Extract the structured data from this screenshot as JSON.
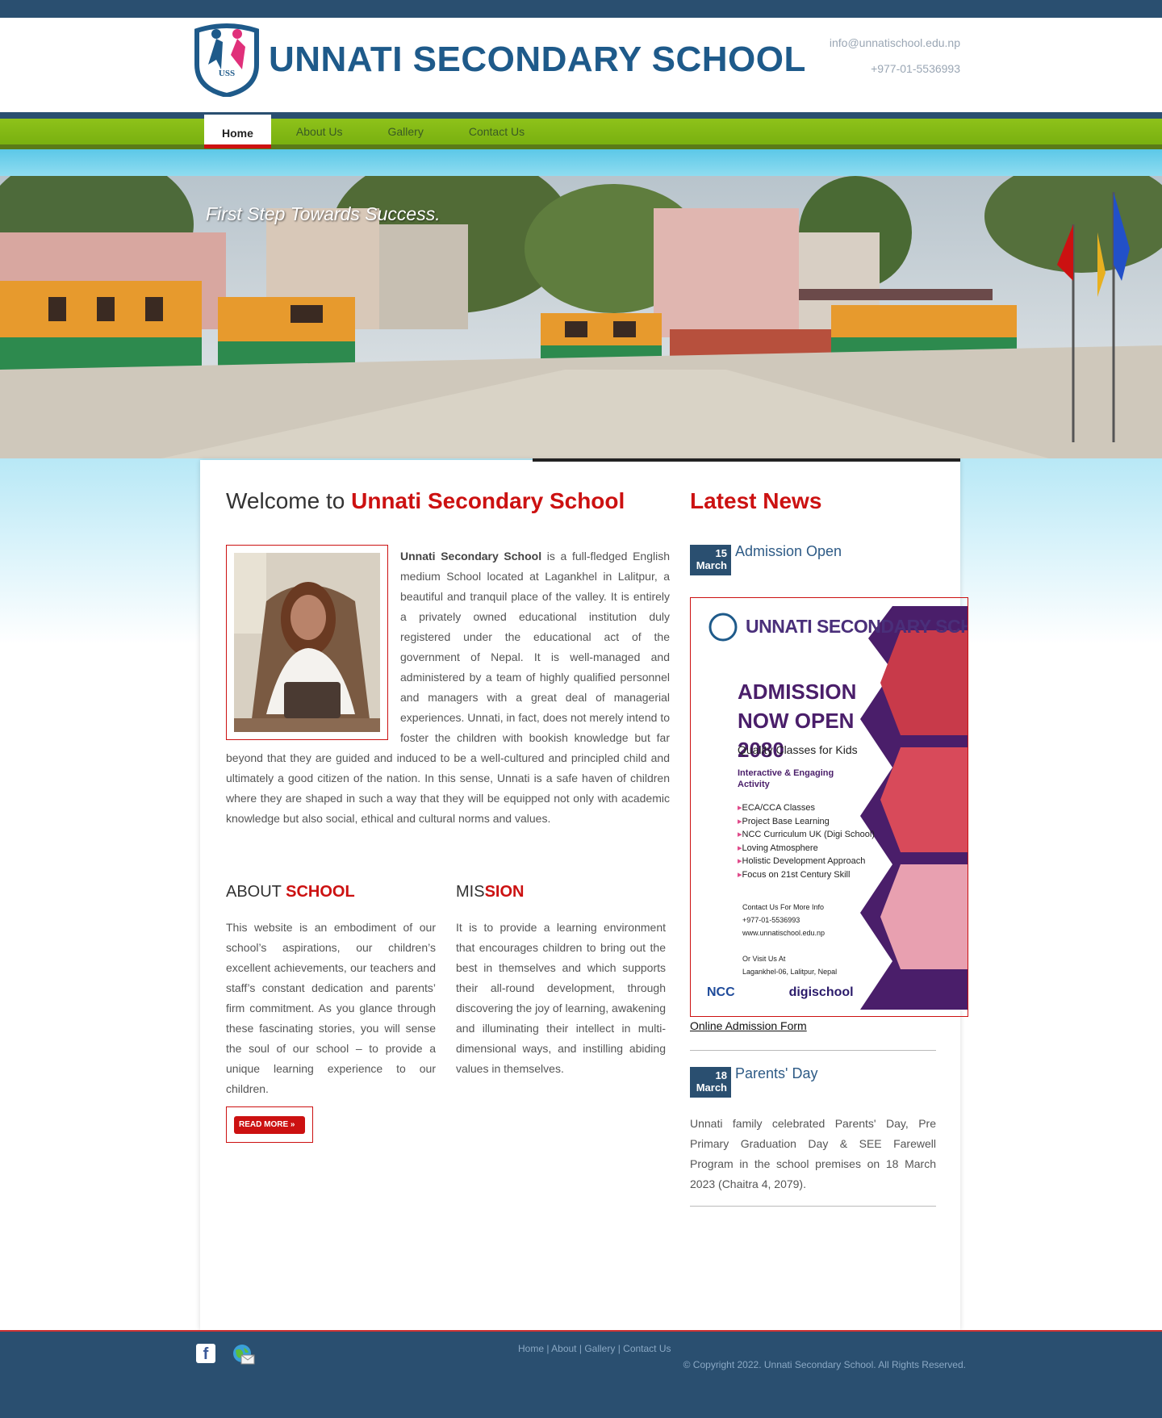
{
  "header": {
    "title": "UNNATI SECONDARY SCHOOL",
    "logo_text": "USS",
    "email": "info@unnatischool.edu.np",
    "phone": "+977-01-5536993"
  },
  "nav": {
    "items": [
      {
        "label": "Home"
      },
      {
        "label": "About Us"
      },
      {
        "label": "Gallery"
      },
      {
        "label": "Contact Us"
      }
    ]
  },
  "banner": {
    "tagline": "First Step Towards Success."
  },
  "welcome": {
    "prefix": "Welcome to",
    "highlight": "Unnati Secondary School",
    "intro_bold": "Unnati Secondary School",
    "intro_text": " is a full-fledged English medium School located at Lagankhel in Lalitpur, a beautiful and tranquil place of the valley. It is entirely a privately owned educational institution duly registered under the educational act of the government of Nepal. It is well-managed and administered by a team of highly qualified personnel and managers with a great deal of managerial experiences. Unnati, in fact, does not merely intend to foster the children with bookish knowledge but far beyond that they are guided and induced to be a well-cultured and principled child and ultimately a good citizen of the nation. In this sense, Unnati is a safe haven of children where they are shaped in such a way that they will be equipped not only with academic knowledge but also social, ethical and cultural norms and values."
  },
  "about": {
    "title_plain": "ABOUT",
    "title_highlight": "SCHOOL",
    "text": "This website is an embodiment of our school’s aspirations, our children’s excellent achievements, our teachers and staff’s constant dedication and parents’ firm commitment. As you glance through these fascinating stories, you will sense the soul of our school – to provide a unique learning experience to our children.",
    "read_more": "READ MORE"
  },
  "mission": {
    "title_plain": "MIS",
    "title_highlight": "SION",
    "text": "It is to provide a learning environment that encourages children to bring out the best in themselves and which supports their all-round development, through discovering the joy of learning, awakening and illuminating their intellect in multi-dimensional ways, and instilling abiding values in themselves."
  },
  "news": {
    "title": "Latest News",
    "items": [
      {
        "day": "15",
        "month": "March",
        "headline": "Admission Open",
        "link": "Online Admission Form"
      },
      {
        "day": "18",
        "month": "March",
        "headline": "Parents' Day",
        "text": "Unnati family celebrated Parents' Day, Pre Primary Graduation Day & SEE Farewell Program in the school premises on 18 March 2023 (Chaitra 4, 2079)."
      }
    ],
    "poster": {
      "brand": "UNNATI SECONDARY SCHOOL",
      "headline": "ADMISSION NOW OPEN 2080",
      "subtitle": "Quality Classes for Kids",
      "activity": "Interactive & Engaging Activity",
      "list": [
        "ECA/CCA Classes",
        "Project Base Learning",
        "NCC Curriculum UK (Digi School)",
        "Loving Atmosphere",
        "Holistic Development Approach",
        "Focus on 21st Century Skill"
      ],
      "contact_lines": [
        "Contact Us For More Info",
        "+977-01-5536993",
        "www.unnatischool.edu.np",
        "",
        "Or Visit Us At",
        "Lagankhel-06, Lalitpur, Nepal"
      ],
      "footer_ncc": "NCC",
      "footer_digi": "digischool"
    }
  },
  "footer": {
    "links": [
      "Home",
      "About",
      "Gallery",
      "Contact Us"
    ],
    "separator": "|",
    "copyright": "© Copyright 2022. Unnati Secondary School. All Rights Reserved."
  },
  "colors": {
    "brand_blue": "#1e5a8a",
    "accent_red": "#cc1111",
    "nav_green": "#8ec21a",
    "footer_blue": "#2a4f70"
  }
}
